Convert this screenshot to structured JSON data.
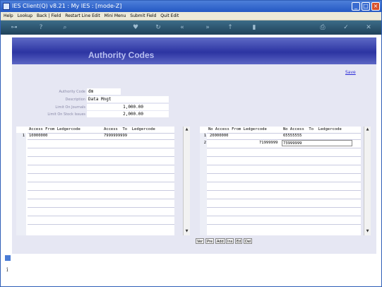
{
  "window": {
    "title": "IES Client(Q) v8.21 : My IES :     [mode-Z]",
    "controls": [
      "minimize",
      "maximize",
      "close"
    ]
  },
  "menu": [
    "Help",
    "Lookup",
    "Back | Field",
    "Restart Line Edit",
    "Mini Menu",
    "Submit Field",
    "Quit Edit"
  ],
  "toolbar_icons": [
    "key-icon",
    "help-icon",
    "search-icon",
    "heart-icon",
    "refresh-icon",
    "back-icon",
    "forward-icon",
    "up-icon",
    "delete-icon",
    "print-icon",
    "ok-icon",
    "close-icon"
  ],
  "banner": {
    "title": "Authority Codes"
  },
  "actions": {
    "save_label": "Save"
  },
  "form": {
    "authority_code": {
      "label": "Authority Code",
      "value": "dm"
    },
    "description": {
      "label": "Description",
      "value": "Data Mngt"
    },
    "limit_journals": {
      "label": "Limit On Journals",
      "value": "1,000.00"
    },
    "limit_stock_issues": {
      "label": "Limit On Stock Issues",
      "value": "2,000.00"
    }
  },
  "left_grid": {
    "headers": [
      "Access From Ledgercode",
      "Access  To  Ledgercode"
    ],
    "rows": [
      {
        "num": "1",
        "from": "10000000",
        "to": "7999999999"
      }
    ]
  },
  "right_grid": {
    "headers": [
      "No Access From Ledgercode",
      "No Access  To  Ledgercode"
    ],
    "rows": [
      {
        "num": "1",
        "from": "20000000",
        "to": "65555555"
      },
      {
        "num": "2",
        "from": "71999999",
        "to": "73999999"
      }
    ]
  },
  "row_buttons": [
    "Ver",
    "Pre",
    "Add",
    "Ins",
    "Ed",
    "Del"
  ],
  "colors": {
    "titlebar": "#2458c4",
    "banner": "#2c34a2",
    "content_bg": "#e6e7f3",
    "link": "#2a2ad8"
  }
}
